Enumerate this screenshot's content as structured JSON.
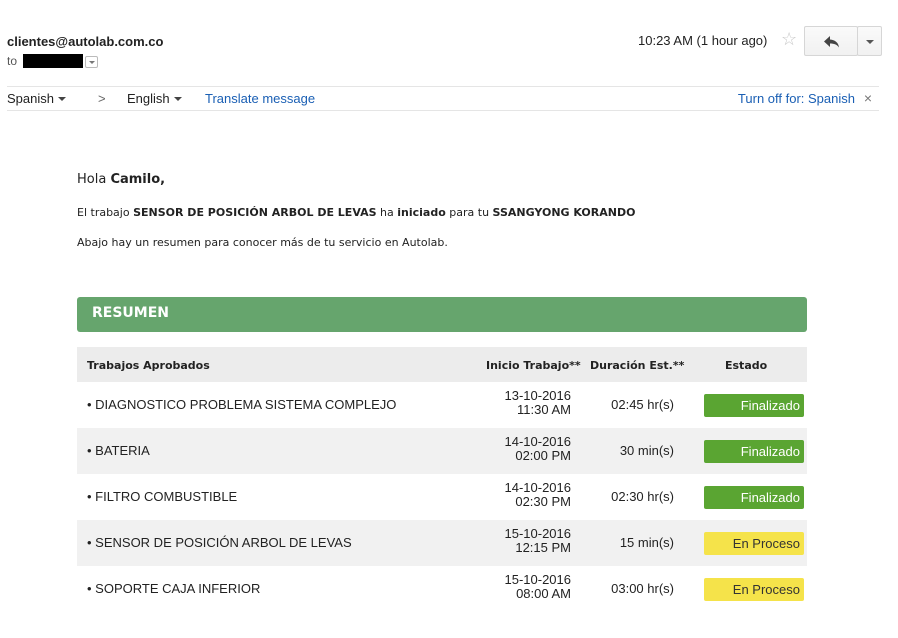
{
  "email": {
    "from": "clientes@autolab.com.co",
    "to_label": "to",
    "time": "10:23 AM (1 hour ago)"
  },
  "icons": {
    "star": "star-outline-icon",
    "reply": "reply-arrow-icon",
    "more": "chevron-down-icon",
    "close": "close-icon"
  },
  "translate_bar": {
    "source_lang": "Spanish",
    "arrow": ">",
    "target_lang": "English",
    "translate_link": "Translate message",
    "turn_off": "Turn off for: Spanish",
    "close": "×"
  },
  "message": {
    "greeting_prefix": "Hola ",
    "greeting_name": "Camilo,",
    "p1_a": "El trabajo ",
    "p1_job": "SENSOR DE POSICIÓN ARBOL DE LEVAS",
    "p1_b": " ha ",
    "p1_status": "iniciado",
    "p1_c": " para tu ",
    "p1_car": "SSANGYONG KORANDO",
    "p2": "Abajo hay un resumen para conocer más de tu servicio en Autolab."
  },
  "summary": {
    "title": "RESUMEN",
    "headers": {
      "job": "Trabajos Aprobados",
      "start": "Inicio Trabajo**",
      "duration": "Duración Est.**",
      "state": "Estado"
    },
    "rows": [
      {
        "job": "• DIAGNOSTICO PROBLEMA SISTEMA COMPLEJO",
        "date": "13-10-2016",
        "time": "11:30 AM",
        "duration": "02:45 hr(s)",
        "state": "Finalizado"
      },
      {
        "job": "• BATERIA",
        "date": "14-10-2016",
        "time": "02:00 PM",
        "duration": "30 min(s)",
        "state": "Finalizado"
      },
      {
        "job": "• FILTRO COMBUSTIBLE",
        "date": "14-10-2016",
        "time": "02:30 PM",
        "duration": "02:30 hr(s)",
        "state": "Finalizado"
      },
      {
        "job": "• SENSOR DE POSICIÓN ARBOL DE LEVAS",
        "date": "15-10-2016",
        "time": "12:15 PM",
        "duration": "15 min(s)",
        "state": "En Proceso"
      },
      {
        "job": "• SOPORTE CAJA INFERIOR",
        "date": "15-10-2016",
        "time": "08:00 AM",
        "duration": "03:00 hr(s)",
        "state": "En Proceso"
      }
    ]
  },
  "colors": {
    "header_green": "#66a56d",
    "done_green": "#5aa532",
    "in_progress_yellow": "#f5e34a",
    "link_blue": "#1a5fb4"
  }
}
